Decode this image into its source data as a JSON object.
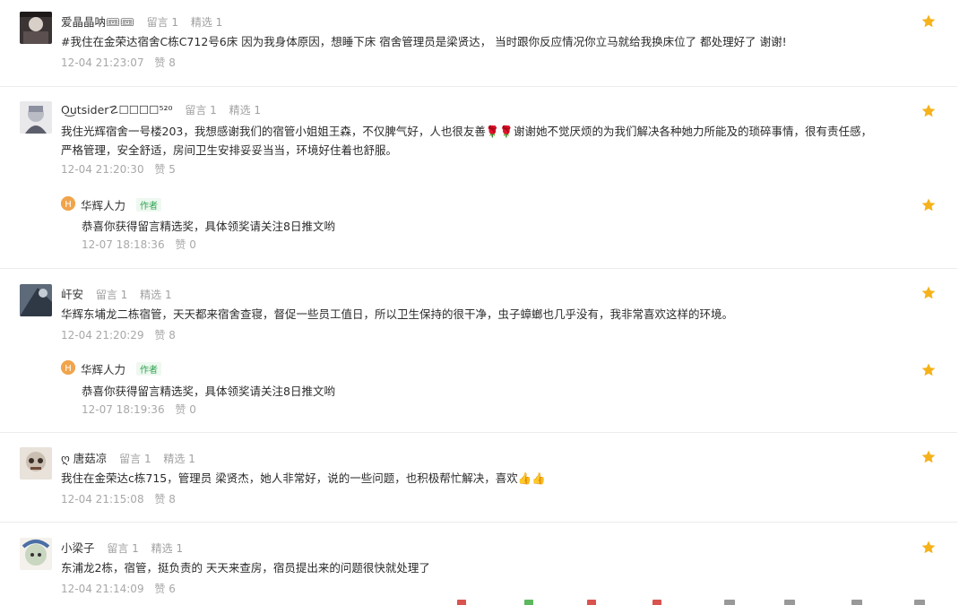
{
  "comments": [
    {
      "nickname": "爱晶晶呐🎟🎟",
      "tag_reply": "留言 1",
      "tag_featured": "精选 1",
      "text": "#我住在金荣达宿舍C栋C712号6床 因为我身体原因，想睡下床 宿舍管理员是梁贤达， 当时跟你反应情况你立马就给我换床位了 都处理好了 谢谢!",
      "time": "12-04 21:23:07",
      "likes": "赞 8"
    },
    {
      "nickname": "O͜utsider☡☐☐☐☐⁵²⁰",
      "tag_reply": "留言 1",
      "tag_featured": "精选 1",
      "text": "我住光辉宿舍一号楼203，我想感谢我们的宿管小姐姐王森，不仅脾气好，人也很友善🌹🌹谢谢她不觉厌烦的为我们解决各种她力所能及的琐碎事情，很有责任感，严格管理，安全舒适，房间卫生安排妥妥当当，环境好住着也舒服。",
      "time": "12-04 21:20:30",
      "likes": "赞 5",
      "reply": {
        "name": "华辉人力",
        "badge": "作者",
        "text": "恭喜你获得留言精选奖，具体领奖请关注8日推文哟",
        "time": "12-07 18:18:36",
        "likes": "赞 0"
      }
    },
    {
      "nickname": "屽安",
      "tag_reply": "留言 1",
      "tag_featured": "精选 1",
      "text": "华辉东埔龙二栋宿管，天天都来宿舍查寝，督促一些员工值日，所以卫生保持的很干净，虫子蟑螂也几乎没有，我非常喜欢这样的环境。",
      "time": "12-04 21:20:29",
      "likes": "赞 8",
      "reply": {
        "name": "华辉人力",
        "badge": "作者",
        "text": "恭喜你获得留言精选奖，具体领奖请关注8日推文哟",
        "time": "12-07 18:19:36",
        "likes": "赞 0"
      }
    },
    {
      "nickname": "ღ 唐菇凉",
      "tag_reply": "留言 1",
      "tag_featured": "精选 1",
      "text": "我住在金荣达c栋715，管理员 梁贤杰，她人非常好，说的一些问题，也积极帮忙解决，喜欢👍👍",
      "time": "12-04 21:15:08",
      "likes": "赞 8"
    },
    {
      "nickname": "小梁子",
      "tag_reply": "留言 1",
      "tag_featured": "精选 1",
      "text": "东浦龙2栋，宿管，挺负责的 天天来查房，宿员提出来的问题很快就处理了",
      "time": "12-04 21:14:09",
      "likes": "赞 6"
    }
  ],
  "colors": {
    "star": "#f5b21a",
    "meta_gray": "#a0a0a0",
    "divider": "#ececec",
    "author_badge": "#2ea44f"
  }
}
